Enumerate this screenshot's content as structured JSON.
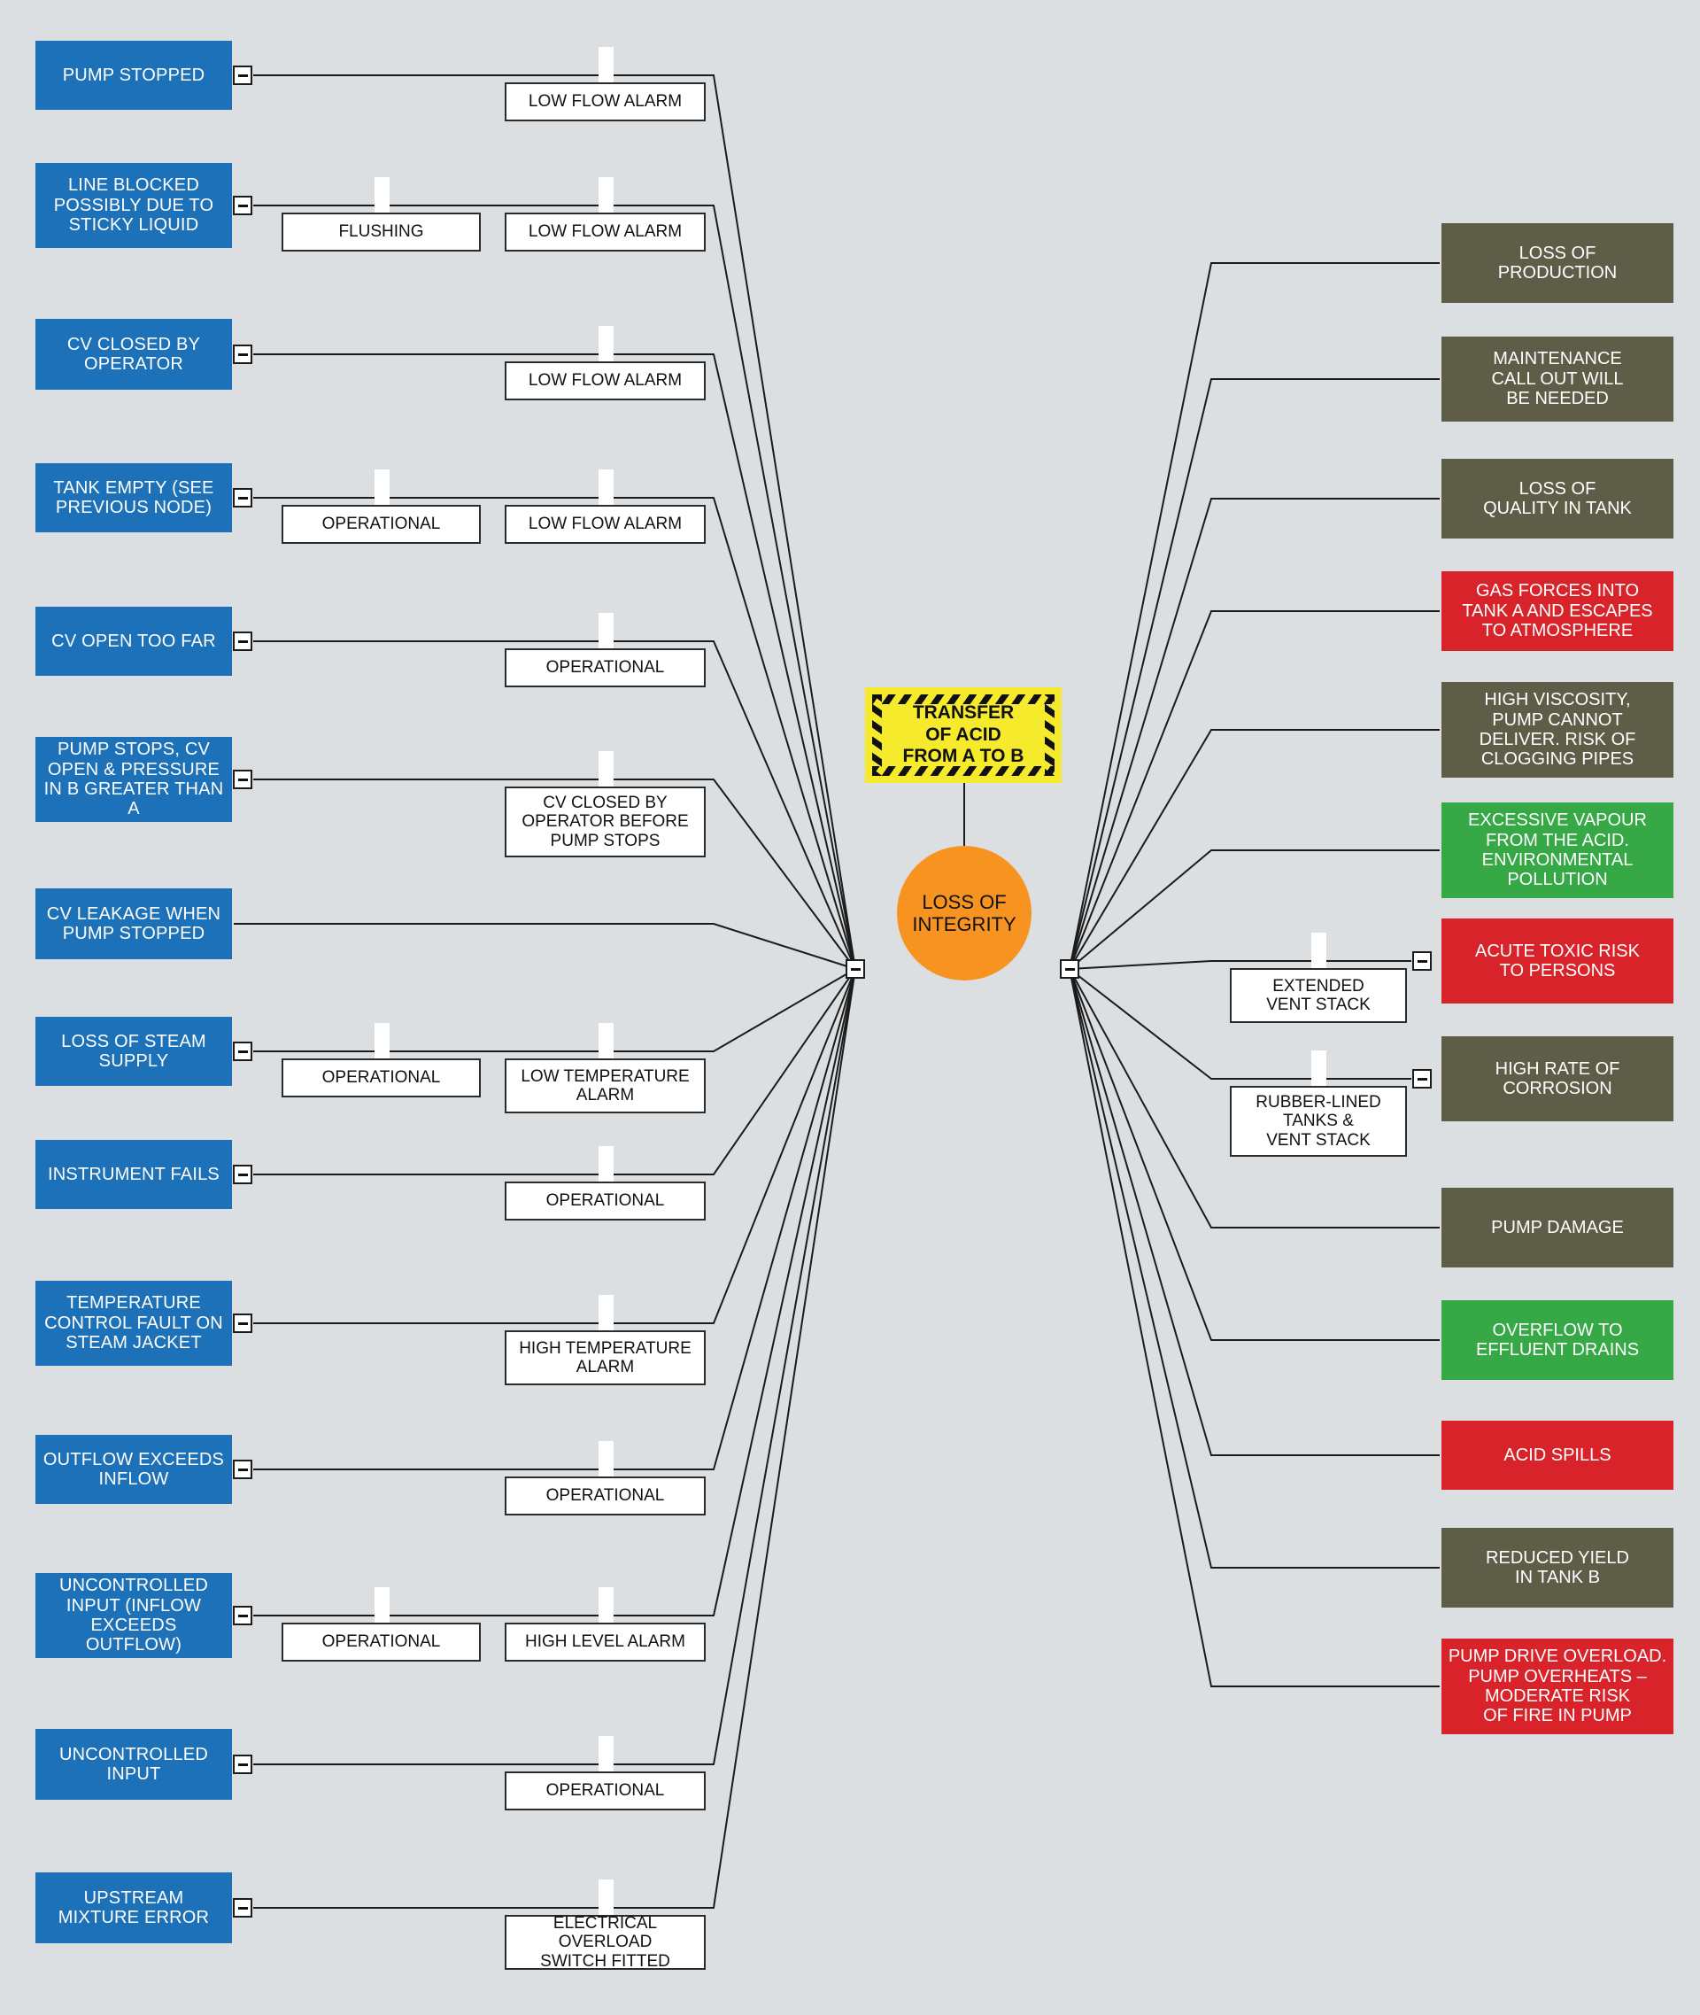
{
  "diagram": {
    "type": "bowtie-risk-diagram",
    "background_color": "#dcdfe1",
    "hazard": {
      "label": "TRANSFER\nOF ACID\nFROM A TO B",
      "line1": "TRANSFER",
      "line2": "OF ACID",
      "line3": "FROM A TO B",
      "color": "#f6ea2c"
    },
    "top_event": {
      "line1": "LOSS OF",
      "line2": "INTEGRITY",
      "color": "#f79421"
    },
    "legend_colors": {
      "threat": "#1d71b8",
      "barrier": "#ffffff",
      "consequence_grey": "#5d5d48",
      "consequence_red": "#d8232a",
      "consequence_green": "#36a845",
      "hazard": "#f6ea2c",
      "top_event": "#f79421"
    }
  },
  "threats": [
    {
      "id": "t1",
      "label": "PUMP STOPPED",
      "has_minus": true,
      "barriers": [
        {
          "label": "LOW FLOW ALARM",
          "col": 2
        }
      ]
    },
    {
      "id": "t2",
      "label": "LINE BLOCKED\nPOSSIBLY DUE TO\nSTICKY LIQUID",
      "has_minus": true,
      "barriers": [
        {
          "label": "FLUSHING",
          "col": 1
        },
        {
          "label": "LOW FLOW ALARM",
          "col": 2
        }
      ]
    },
    {
      "id": "t3",
      "label": "CV CLOSED BY\nOPERATOR",
      "has_minus": true,
      "barriers": [
        {
          "label": "LOW FLOW ALARM",
          "col": 2
        }
      ]
    },
    {
      "id": "t4",
      "label": "TANK EMPTY (SEE\nPREVIOUS NODE)",
      "has_minus": true,
      "barriers": [
        {
          "label": "OPERATIONAL",
          "col": 1
        },
        {
          "label": "LOW FLOW ALARM",
          "col": 2
        }
      ]
    },
    {
      "id": "t5",
      "label": "CV OPEN TOO FAR",
      "has_minus": true,
      "barriers": [
        {
          "label": "OPERATIONAL",
          "col": 2
        }
      ]
    },
    {
      "id": "t6",
      "label": "PUMP STOPS, CV\nOPEN & PRESSURE\nIN B GREATER THAN A",
      "has_minus": true,
      "barriers": [
        {
          "label": "CV CLOSED BY\nOPERATOR BEFORE\nPUMP STOPS",
          "col": 2
        }
      ]
    },
    {
      "id": "t7",
      "label": "CV LEAKAGE WHEN\nPUMP STOPPED",
      "has_minus": false,
      "barriers": []
    },
    {
      "id": "t8",
      "label": "LOSS OF STEAM\nSUPPLY",
      "has_minus": true,
      "barriers": [
        {
          "label": "OPERATIONAL",
          "col": 1
        },
        {
          "label": "LOW TEMPERATURE\nALARM",
          "col": 2
        }
      ]
    },
    {
      "id": "t9",
      "label": "INSTRUMENT FAILS",
      "has_minus": true,
      "barriers": [
        {
          "label": "OPERATIONAL",
          "col": 2
        }
      ]
    },
    {
      "id": "t10",
      "label": "TEMPERATURE\nCONTROL FAULT ON\nSTEAM JACKET",
      "has_minus": true,
      "barriers": [
        {
          "label": "HIGH TEMPERATURE\nALARM",
          "col": 2
        }
      ]
    },
    {
      "id": "t11",
      "label": "OUTFLOW EXCEEDS\nINFLOW",
      "has_minus": true,
      "barriers": [
        {
          "label": "OPERATIONAL",
          "col": 2
        }
      ]
    },
    {
      "id": "t12",
      "label": "UNCONTROLLED\nINPUT (INFLOW\nEXCEEDS OUTFLOW)",
      "has_minus": true,
      "barriers": [
        {
          "label": "OPERATIONAL",
          "col": 1
        },
        {
          "label": "HIGH LEVEL ALARM",
          "col": 2
        }
      ]
    },
    {
      "id": "t13",
      "label": "UNCONTROLLED\nINPUT",
      "has_minus": true,
      "barriers": [
        {
          "label": "OPERATIONAL",
          "col": 2
        }
      ]
    },
    {
      "id": "t14",
      "label": "UPSTREAM\nMIXTURE ERROR",
      "has_minus": true,
      "barriers": [
        {
          "label": "ELECTRICAL OVERLOAD\nSWITCH FITTED",
          "col": 2
        }
      ]
    }
  ],
  "consequences": [
    {
      "id": "c1",
      "label": "LOSS OF\nPRODUCTION",
      "severity": "grey",
      "has_minus": false,
      "barriers": []
    },
    {
      "id": "c2",
      "label": "MAINTENANCE\nCALL OUT WILL\nBE NEEDED",
      "severity": "grey",
      "has_minus": false,
      "barriers": []
    },
    {
      "id": "c3",
      "label": "LOSS OF\nQUALITY IN TANK",
      "severity": "grey",
      "has_minus": false,
      "barriers": []
    },
    {
      "id": "c4",
      "label": "GAS FORCES INTO\nTANK A AND ESCAPES\nTO ATMOSPHERE",
      "severity": "red",
      "has_minus": false,
      "barriers": []
    },
    {
      "id": "c5",
      "label": "HIGH VISCOSITY,\nPUMP CANNOT\nDELIVER. RISK OF\nCLOGGING PIPES",
      "severity": "grey",
      "has_minus": false,
      "barriers": []
    },
    {
      "id": "c6",
      "label": "EXCESSIVE VAPOUR\nFROM THE ACID.\nENVIRONMENTAL\nPOLLUTION",
      "severity": "green",
      "has_minus": false,
      "barriers": []
    },
    {
      "id": "c7",
      "label": "ACUTE TOXIC RISK\nTO PERSONS",
      "severity": "red",
      "has_minus": true,
      "barriers": [
        {
          "label": "EXTENDED\nVENT STACK"
        }
      ]
    },
    {
      "id": "c8",
      "label": "HIGH RATE OF\nCORROSION",
      "severity": "grey",
      "has_minus": true,
      "barriers": [
        {
          "label": "RUBBER-LINED\nTANKS &\nVENT STACK"
        }
      ]
    },
    {
      "id": "c9",
      "label": "PUMP DAMAGE",
      "severity": "grey",
      "has_minus": false,
      "barriers": []
    },
    {
      "id": "c10",
      "label": "OVERFLOW TO\nEFFLUENT DRAINS",
      "severity": "green",
      "has_minus": false,
      "barriers": []
    },
    {
      "id": "c11",
      "label": "ACID SPILLS",
      "severity": "red",
      "has_minus": false,
      "barriers": []
    },
    {
      "id": "c12",
      "label": "REDUCED YIELD\nIN TANK B",
      "severity": "grey",
      "has_minus": false,
      "barriers": []
    },
    {
      "id": "c13",
      "label": "PUMP DRIVE OVERLOAD.\nPUMP OVERHEATS –\nMODERATE RISK\nOF FIRE IN PUMP",
      "severity": "red",
      "has_minus": false,
      "barriers": []
    }
  ]
}
